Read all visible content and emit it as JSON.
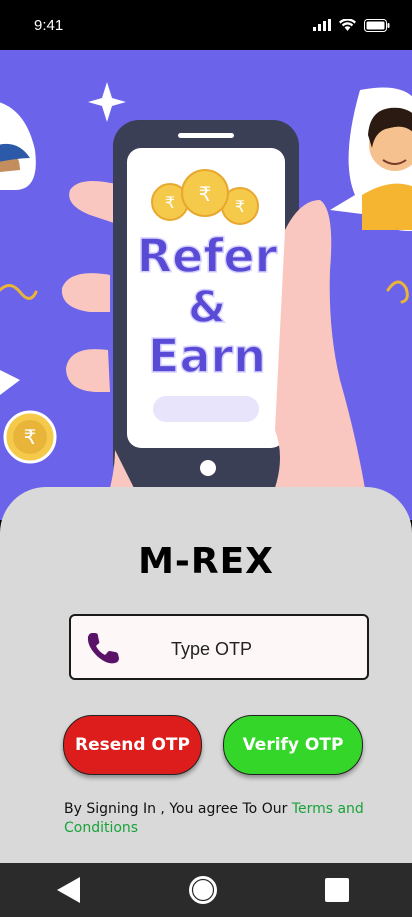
{
  "status_bar": {
    "time": "9:41"
  },
  "hero": {
    "alt_title_line1": "Refer",
    "alt_title_line2": "&",
    "alt_title_line3": "Earn",
    "colors": {
      "background": "#6b63ea",
      "phone": "#3a3f55",
      "accent_text": "#5a4bd6"
    }
  },
  "login": {
    "brand": "M-REX",
    "otp_placeholder": "Type OTP",
    "resend_label": "Resend OTP",
    "verify_label": "Verify OTP",
    "terms_prefix": "By Signing In , You agree To Our ",
    "terms_link": "Terms and Conditions",
    "colors": {
      "resend": "#dd1c1c",
      "verify": "#35d62a",
      "link": "#18a33a",
      "phone_icon": "#5a1268"
    }
  },
  "nav": {
    "icons": [
      "back-icon",
      "home-icon",
      "recents-icon"
    ]
  }
}
